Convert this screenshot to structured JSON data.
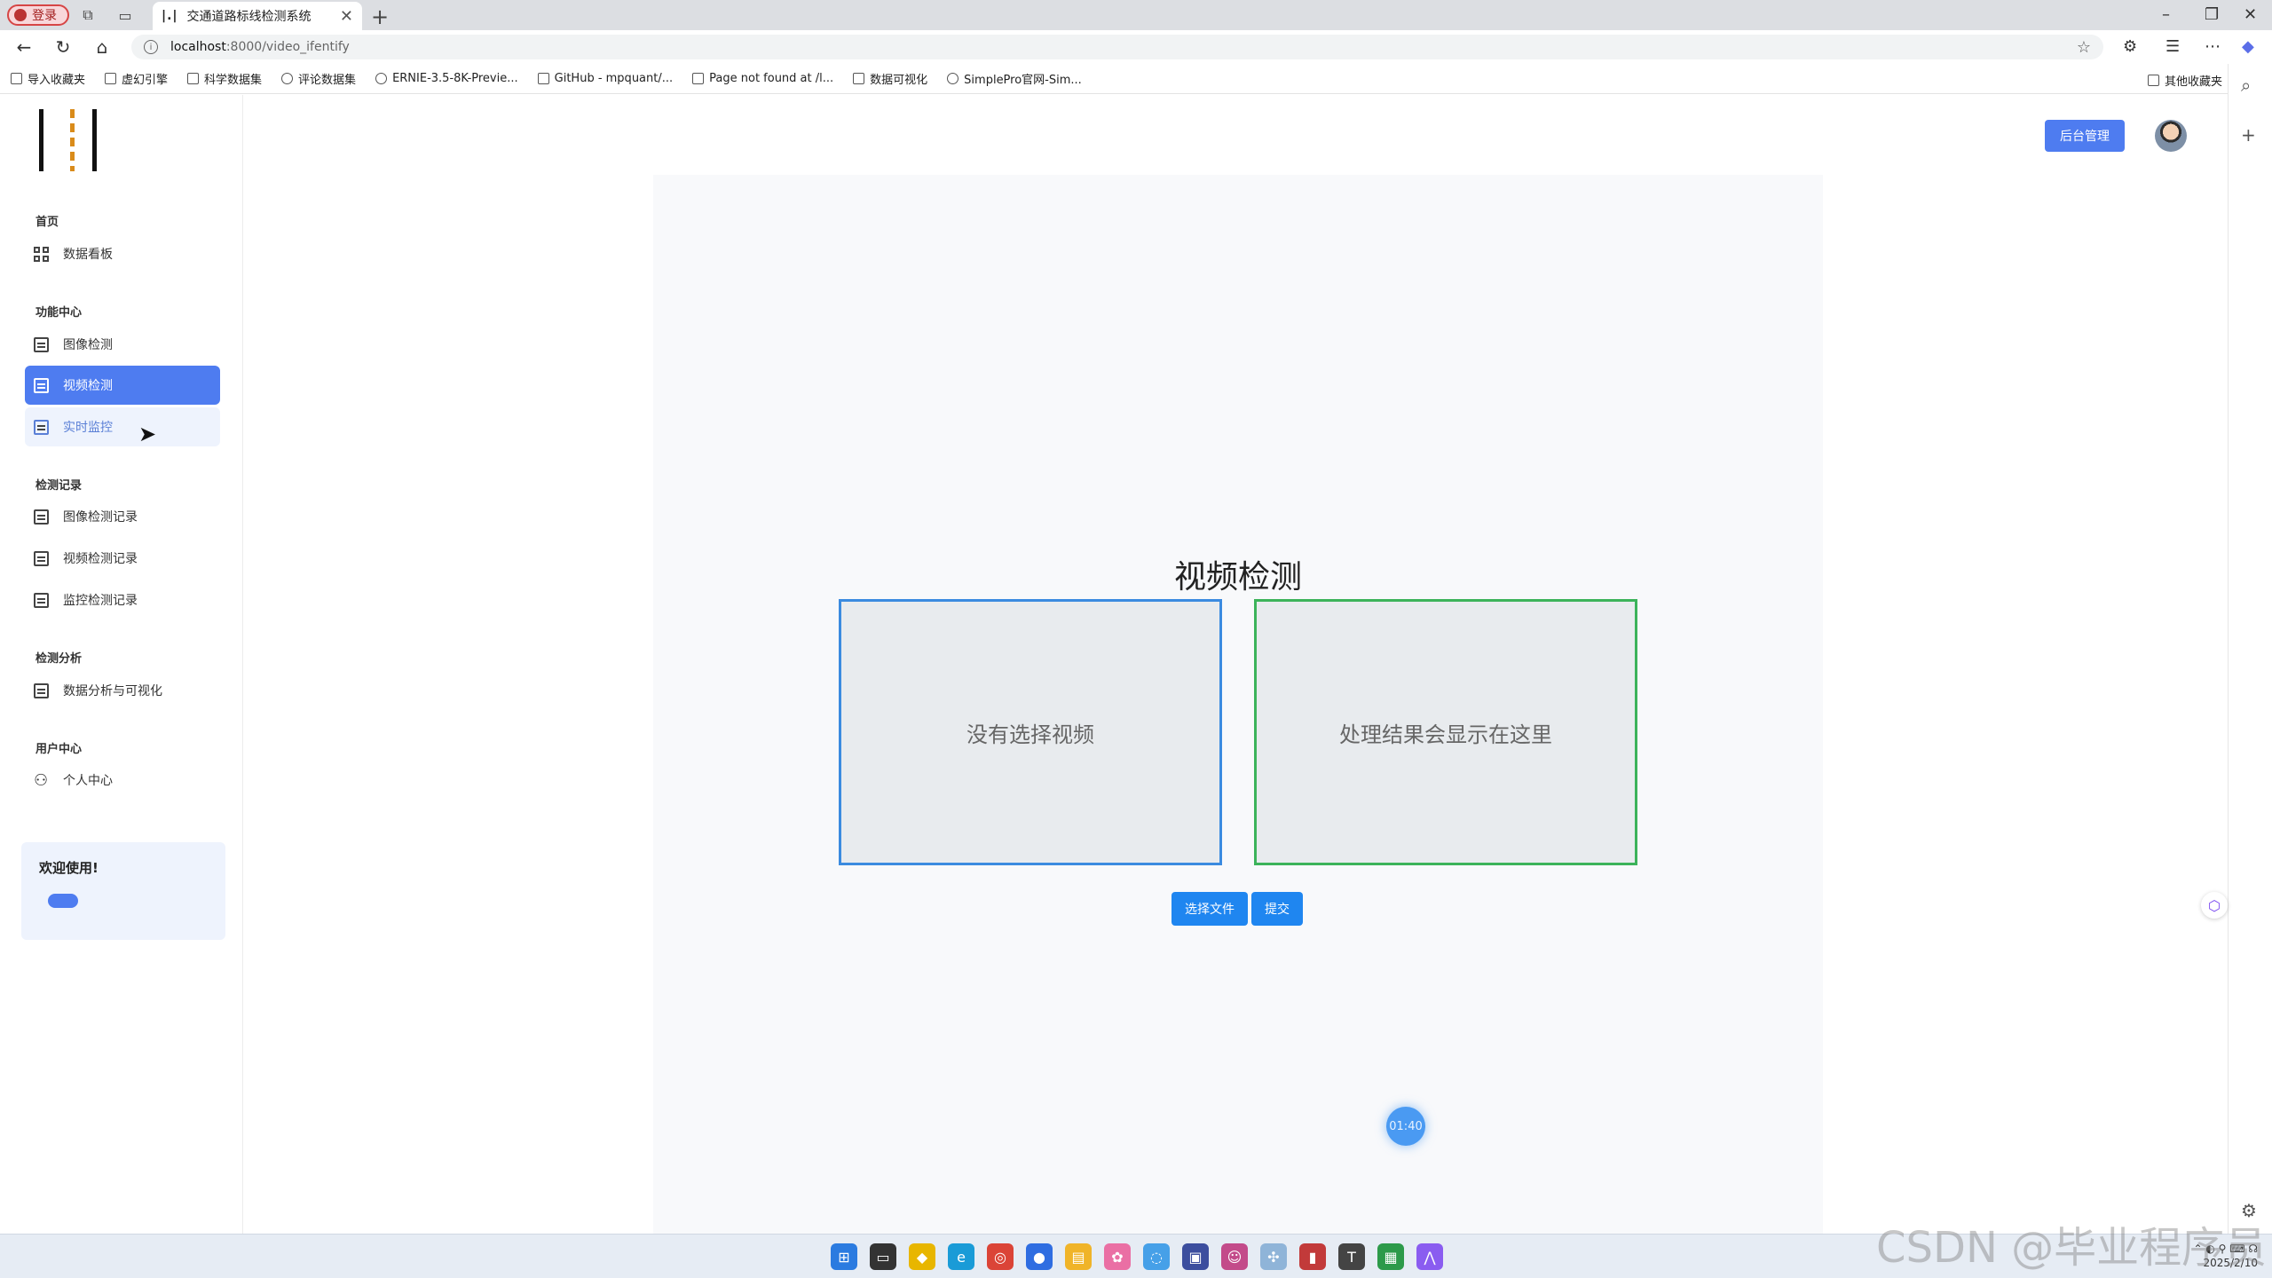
{
  "browser": {
    "profile_label": "登录",
    "tab_title": "交通道路标线检测系统",
    "tab_favicon": "|.|",
    "url_host": "localhost",
    "url_path": ":8000/video_ifentify",
    "bookmarks": [
      "导入收藏夹",
      "虚幻引擎",
      "科学数据集",
      "评论数据集",
      "ERNIE-3.5-8K-Previe...",
      "GitHub - mpquant/...",
      "Page not found at /l...",
      "数据可视化",
      "SimplePro官网-Sim..."
    ],
    "other_bookmarks": "其他收藏夹"
  },
  "sidebar": {
    "sections": [
      {
        "title": "首页",
        "items": [
          "数据看板"
        ]
      },
      {
        "title": "功能中心",
        "items": [
          "图像检测",
          "视频检测",
          "实时监控"
        ]
      },
      {
        "title": "检测记录",
        "items": [
          "图像检测记录",
          "视频检测记录",
          "监控检测记录"
        ]
      },
      {
        "title": "检测分析",
        "items": [
          "数据分析与可视化"
        ]
      },
      {
        "title": "用户中心",
        "items": [
          "个人中心"
        ]
      }
    ],
    "active_item": "视频检测",
    "welcome_text": "欢迎使用!"
  },
  "header": {
    "admin_label": "后台管理"
  },
  "main": {
    "title": "视频检测",
    "input_placeholder": "没有选择视频",
    "output_placeholder": "处理结果会显示在这里",
    "choose_label": "选择文件",
    "submit_label": "提交",
    "timer": "01:40"
  },
  "taskbar": {
    "date": "2025/2/10"
  },
  "watermark": "CSDN @毕业程序员",
  "colors": {
    "accent": "#4e7cf0",
    "input_border": "#3b8be0",
    "output_border": "#3cb35a",
    "button": "#1f86f0"
  }
}
